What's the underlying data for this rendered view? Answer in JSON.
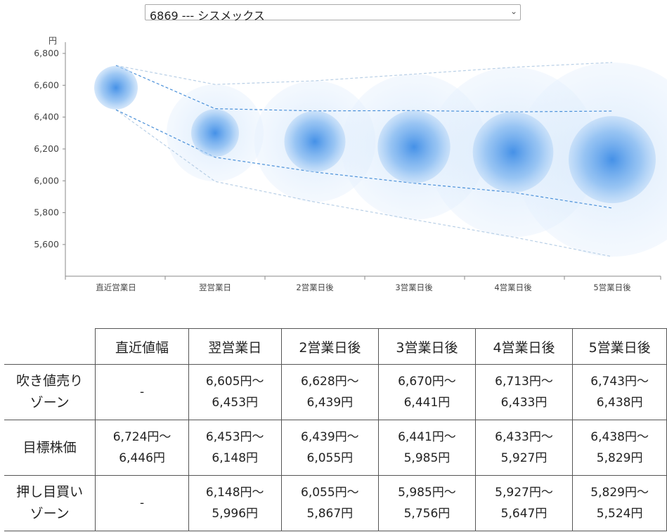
{
  "selector": {
    "value": "6869 --- シスメックス"
  },
  "chart_data": {
    "type": "scatter",
    "y_unit": "円",
    "categories": [
      "直近営業日",
      "翌営業日",
      "2営業日後",
      "3営業日後",
      "4営業日後",
      "5営業日後"
    ],
    "yticks": [
      "6,800",
      "6,600",
      "6,400",
      "6,200",
      "6,000",
      "5,800",
      "5,600"
    ],
    "ylim": [
      5400,
      6800
    ],
    "grid": false,
    "center_prices": [
      6585,
      6300,
      6247,
      6213,
      6180,
      6133
    ],
    "target_zone": {
      "high": [
        6724,
        6453,
        6439,
        6441,
        6433,
        6438
      ],
      "low": [
        6446,
        6148,
        6055,
        5985,
        5927,
        5829
      ]
    },
    "outer_zone": {
      "high": [
        6724,
        6605,
        6628,
        6670,
        6713,
        6743
      ],
      "low": [
        6446,
        5996,
        5867,
        5756,
        5647,
        5524
      ]
    },
    "colors": {
      "core": "#3d8ce6",
      "halo": "#cfe4fb",
      "inner_dash": "#4a90d9",
      "outer_dash": "#b8cfe6",
      "axis": "#888888"
    }
  },
  "table": {
    "headers": [
      "",
      "直近値幅",
      "翌営業日",
      "2営業日後",
      "3営業日後",
      "4営業日後",
      "5営業日後"
    ],
    "rows": [
      {
        "label": [
          "吹き値売り",
          "ゾーン"
        ],
        "cells": [
          [
            "-"
          ],
          [
            "6,605円～",
            "6,453円"
          ],
          [
            "6,628円～",
            "6,439円"
          ],
          [
            "6,670円～",
            "6,441円"
          ],
          [
            "6,713円～",
            "6,433円"
          ],
          [
            "6,743円～",
            "6,438円"
          ]
        ]
      },
      {
        "label": [
          "目標株価"
        ],
        "cells": [
          [
            "6,724円～",
            "6,446円"
          ],
          [
            "6,453円～",
            "6,148円"
          ],
          [
            "6,439円～",
            "6,055円"
          ],
          [
            "6,441円～",
            "5,985円"
          ],
          [
            "6,433円～",
            "5,927円"
          ],
          [
            "6,438円～",
            "5,829円"
          ]
        ]
      },
      {
        "label": [
          "押し目買い",
          "ゾーン"
        ],
        "cells": [
          [
            "-"
          ],
          [
            "6,148円～",
            "5,996円"
          ],
          [
            "6,055円～",
            "5,867円"
          ],
          [
            "5,985円～",
            "5,756円"
          ],
          [
            "5,927円～",
            "5,647円"
          ],
          [
            "5,829円～",
            "5,524円"
          ]
        ]
      }
    ]
  }
}
